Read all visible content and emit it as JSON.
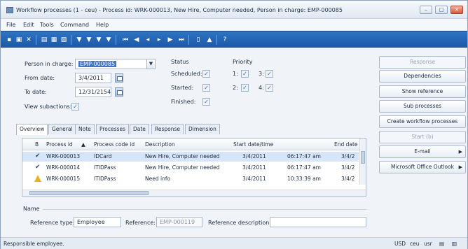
{
  "window": {
    "title": "Workflow processes (1 - ceu) - Process id: WRK-000013, New Hire, Computer needed, Person in charge: EMP-000085",
    "buttons": {
      "minimize": "–",
      "maximize": "□",
      "close": "✕"
    }
  },
  "menu": [
    "File",
    "Edit",
    "Tools",
    "Command",
    "Help"
  ],
  "toolbar": {
    "icons": [
      "new-icon",
      "save-icon",
      "delete-icon",
      "print-icon",
      "preview-icon",
      "copy-icon",
      "filter-icon",
      "filter-selection-icon",
      "advanced-filter-icon",
      "clear-filter-icon",
      "first-record-icon",
      "previous-page-icon",
      "previous-record-icon",
      "next-record-icon",
      "next-page-icon",
      "last-record-icon",
      "document-icon",
      "alert-icon",
      "help-icon"
    ]
  },
  "filters": {
    "person_in_charge_label": "Person in charge:",
    "person_in_charge_value": "EMP-000085",
    "from_date_label": "From date:",
    "from_date_value": "3/4/2011",
    "to_date_label": "To date:",
    "to_date_value": "12/31/2154",
    "view_subactions_label": "View subactions:",
    "view_subactions_checked": true
  },
  "status": {
    "heading": "Status",
    "scheduled_label": "Scheduled:",
    "started_label": "Started:",
    "finished_label": "Finished:"
  },
  "priority": {
    "heading": "Priority",
    "p1_label": "1:",
    "p2_label": "2:",
    "p3_label": "3:",
    "p4_label": "4:"
  },
  "side_buttons": {
    "response": "Response",
    "dependencies": "Dependencies",
    "show_reference": "Show reference",
    "sub_processes": "Sub processes",
    "create_workflow_processes": "Create workflow processes",
    "start": "Start (b)",
    "email": "E-mail",
    "outlook": "Microsoft Office Outlook"
  },
  "tabs": [
    "Overview",
    "General",
    "Note",
    "Processes",
    "Date",
    "Response",
    "Dimension"
  ],
  "grid": {
    "columns": [
      "B",
      "Process id",
      "Process code id",
      "Description",
      "Start date/time",
      "End date"
    ],
    "rows": [
      {
        "status": "check",
        "process_id": "WRK-000013",
        "code": "IDCard",
        "description": "New Hire, Computer needed",
        "start_date": "3/4/2011",
        "start_time": "06:17:47 am",
        "end_date": "3/4/2"
      },
      {
        "status": "check",
        "process_id": "WRK-000014",
        "code": "ITIDPass",
        "description": "New Hire, Computer needed",
        "start_date": "3/4/2011",
        "start_time": "06:17:47 am",
        "end_date": "3/4/2"
      },
      {
        "status": "warning",
        "process_id": "WRK-000015",
        "code": "ITIDPass",
        "description": "Need info",
        "start_date": "3/4/2011",
        "start_time": "10:33:39 am",
        "end_date": "3/4/2"
      }
    ]
  },
  "name_section": {
    "heading": "Name",
    "reference_type_label": "Reference type:",
    "reference_type_value": "Employee",
    "reference_label": "Reference:",
    "reference_value": "EMP-000119",
    "reference_description_label": "Reference description:",
    "reference_description_value": ""
  },
  "statusbar": {
    "help_text": "Responsible employee.",
    "currency": "USD",
    "company": "ceu",
    "layer": "usr"
  }
}
